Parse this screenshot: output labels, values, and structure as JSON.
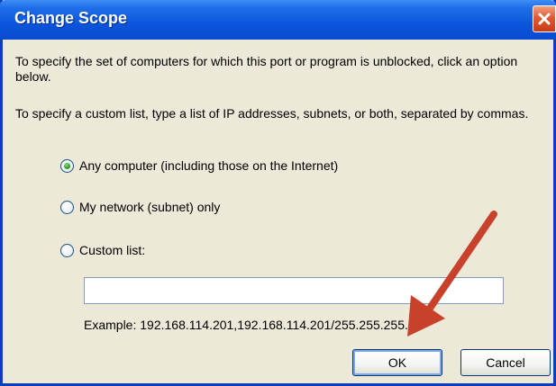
{
  "window": {
    "title": "Change Scope"
  },
  "content": {
    "paragraph1": "To specify the set of computers for which this port or program is unblocked, click an option below.",
    "paragraph2": "To specify a custom list, type a list of IP addresses, subnets, or both, separated by commas."
  },
  "options": {
    "any_computer": {
      "label": "Any computer (including those on the Internet)",
      "selected": true
    },
    "my_network": {
      "label": "My network (subnet) only",
      "selected": false
    },
    "custom_list": {
      "label": "Custom list:",
      "selected": false
    }
  },
  "custom_input": {
    "value": ""
  },
  "example_text": "Example: 192.168.114.201,192.168.114.201/255.255.255.0",
  "buttons": {
    "ok": "OK",
    "cancel": "Cancel"
  },
  "colors": {
    "title_bar": "#0b56dc",
    "dialog_bg": "#ece9d8",
    "close_button": "#e05a30",
    "annotation_arrow": "#c8412b",
    "radio_selected": "#2ea22a"
  },
  "icons": {
    "close": "close-x-icon",
    "annotation": "red-arrow-icon"
  }
}
